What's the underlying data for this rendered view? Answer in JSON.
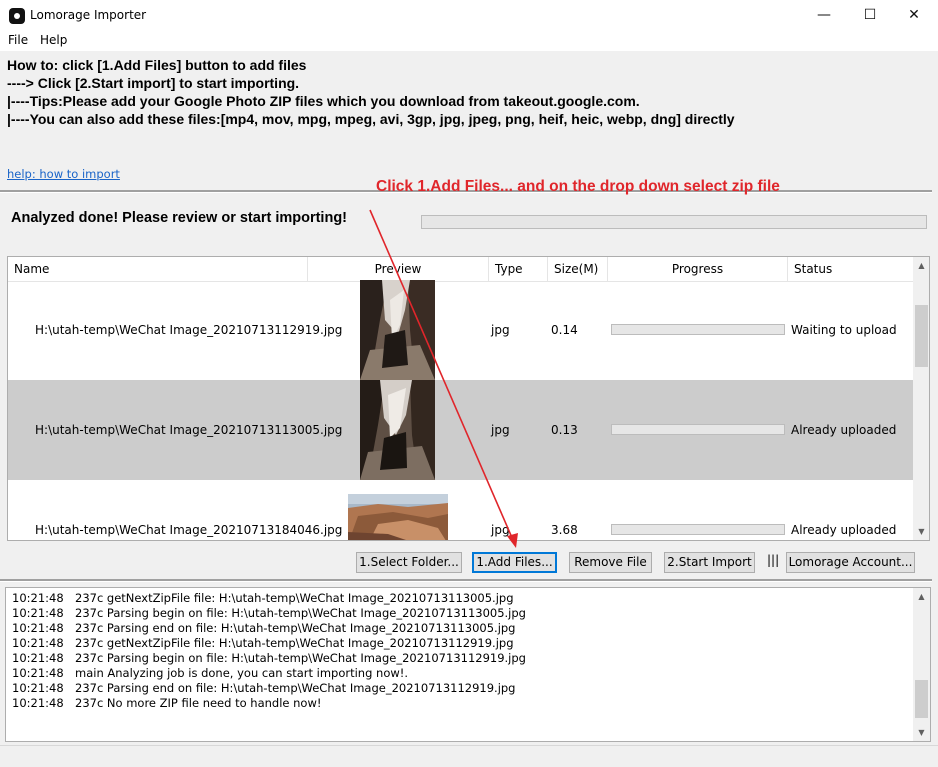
{
  "window": {
    "title": "Lomorage Importer",
    "controls": {
      "minimize": "—",
      "maximize": "☐",
      "close": "✕"
    }
  },
  "menu": [
    {
      "label": "File"
    },
    {
      "label": "Help"
    }
  ],
  "instructions": [
    "How to: click [1.Add Files] button to add files",
    "----> Click [2.Start import] to start importing.",
    "|----Tips:Please add your Google Photo ZIP files which you download from takeout.google.com.",
    "|----You can also add these files:[mp4, mov, mpg, mpeg, avi, 3gp, jpg, jpeg, png, heif, heic, webp, dng] directly"
  ],
  "help_link": "help: how to import",
  "annotation": {
    "text": "Click 1.Add Files... and on the drop down select zip file",
    "color": "#e0262b"
  },
  "status_text": "Analyzed done! Please review or start importing!",
  "table": {
    "columns": [
      "Name",
      "Preview",
      "Type",
      "Size(M)",
      "Progress",
      "Status"
    ],
    "rows": [
      {
        "name": "H:\\utah-temp\\WeChat Image_20210713112919.jpg",
        "preview": "canyon-photo-portrait",
        "type": "jpg",
        "size": "0.14",
        "progress": 0,
        "status": "Waiting to upload",
        "selected": false
      },
      {
        "name": "H:\\utah-temp\\WeChat Image_20210713113005.jpg",
        "preview": "canyon-photo-portrait",
        "type": "jpg",
        "size": "0.13",
        "progress": 0,
        "status": "Already uploaded",
        "selected": true
      },
      {
        "name": "H:\\utah-temp\\WeChat Image_20210713184046.jpg",
        "preview": "canyon-photo-landscape",
        "type": "jpg",
        "size": "3.68",
        "progress": 0,
        "status": "Already uploaded",
        "selected": false
      }
    ]
  },
  "buttons": {
    "select_folder": "1.Select Folder...",
    "add_files": "1.Add Files...",
    "remove_file": "Remove File",
    "start_import": "2.Start Import",
    "divider": "|||",
    "account": "Lomorage Account..."
  },
  "log": [
    {
      "time": "10:21:48",
      "msg": "237c getNextZipFile file: H:\\utah-temp\\WeChat Image_20210713113005.jpg"
    },
    {
      "time": "10:21:48",
      "msg": "237c Parsing begin on file: H:\\utah-temp\\WeChat Image_20210713113005.jpg"
    },
    {
      "time": "10:21:48",
      "msg": "237c Parsing end on file: H:\\utah-temp\\WeChat Image_20210713113005.jpg"
    },
    {
      "time": "10:21:48",
      "msg": "237c getNextZipFile file: H:\\utah-temp\\WeChat Image_20210713112919.jpg"
    },
    {
      "time": "10:21:48",
      "msg": "237c Parsing begin on file: H:\\utah-temp\\WeChat Image_20210713112919.jpg"
    },
    {
      "time": "10:21:48",
      "msg": "main Analyzing job is done, you can start importing now!."
    },
    {
      "time": "10:21:48",
      "msg": "237c Parsing end on file: H:\\utah-temp\\WeChat Image_20210713112919.jpg"
    },
    {
      "time": "10:21:48",
      "msg": "237c No more ZIP file need to handle now!"
    }
  ]
}
